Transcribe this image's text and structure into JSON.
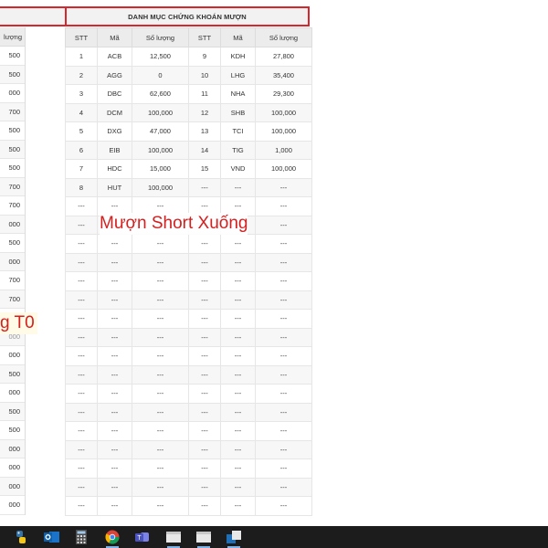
{
  "title": "DANH MỤC CHỨNG KHOÁN MƯỢN",
  "left_table": {
    "header": "lượng",
    "values": [
      "500",
      "500",
      "000",
      "700",
      "500",
      "500",
      "500",
      "700",
      "700",
      "000",
      "500",
      "000",
      "700",
      "700",
      "000",
      "000",
      "000",
      "500",
      "000",
      "500",
      "500",
      "000",
      "000",
      "000",
      "000"
    ]
  },
  "table": {
    "headers": [
      "STT",
      "Mã",
      "Số lượng",
      "STT",
      "Mã",
      "Số lượng"
    ],
    "rows": [
      [
        "1",
        "ACB",
        "12,500",
        "9",
        "KDH",
        "27,800"
      ],
      [
        "2",
        "AGG",
        "0",
        "10",
        "LHG",
        "35,400"
      ],
      [
        "3",
        "DBC",
        "62,600",
        "11",
        "NHA",
        "29,300"
      ],
      [
        "4",
        "DCM",
        "100,000",
        "12",
        "SHB",
        "100,000"
      ],
      [
        "5",
        "DXG",
        "47,000",
        "13",
        "TCI",
        "100,000"
      ],
      [
        "6",
        "EIB",
        "100,000",
        "14",
        "TIG",
        "1,000"
      ],
      [
        "7",
        "HDC",
        "15,000",
        "15",
        "VND",
        "100,000"
      ],
      [
        "8",
        "HUT",
        "100,000",
        "---",
        "---",
        "---"
      ],
      [
        "---",
        "---",
        "---",
        "---",
        "---",
        "---"
      ],
      [
        "---",
        "---",
        "---",
        "---",
        "---",
        "---"
      ],
      [
        "---",
        "---",
        "---",
        "---",
        "---",
        "---"
      ],
      [
        "---",
        "---",
        "---",
        "---",
        "---",
        "---"
      ],
      [
        "---",
        "---",
        "---",
        "---",
        "---",
        "---"
      ],
      [
        "---",
        "---",
        "---",
        "---",
        "---",
        "---"
      ],
      [
        "---",
        "---",
        "---",
        "---",
        "---",
        "---"
      ],
      [
        "---",
        "---",
        "---",
        "---",
        "---",
        "---"
      ],
      [
        "---",
        "---",
        "---",
        "---",
        "---",
        "---"
      ],
      [
        "---",
        "---",
        "---",
        "---",
        "---",
        "---"
      ],
      [
        "---",
        "---",
        "---",
        "---",
        "---",
        "---"
      ],
      [
        "---",
        "---",
        "---",
        "---",
        "---",
        "---"
      ],
      [
        "---",
        "---",
        "---",
        "---",
        "---",
        "---"
      ],
      [
        "---",
        "---",
        "---",
        "---",
        "---",
        "---"
      ],
      [
        "---",
        "---",
        "---",
        "---",
        "---",
        "---"
      ],
      [
        "---",
        "---",
        "---",
        "---",
        "---",
        "---"
      ],
      [
        "---",
        "---",
        "---",
        "---",
        "---",
        "---"
      ]
    ]
  },
  "annotations": {
    "main": "Mượn Short Xuống",
    "left": "g T0"
  },
  "taskbar": {
    "icons": [
      "python-icon",
      "outlook-icon",
      "calculator-icon",
      "chrome-icon",
      "teams-icon",
      "window-icon-1",
      "window-icon-2",
      "window-icon-3"
    ]
  },
  "colors": {
    "highlight_border": "#d9262c",
    "annotation_text": "#d41f1f",
    "taskbar_bg": "#1c1c1c"
  }
}
